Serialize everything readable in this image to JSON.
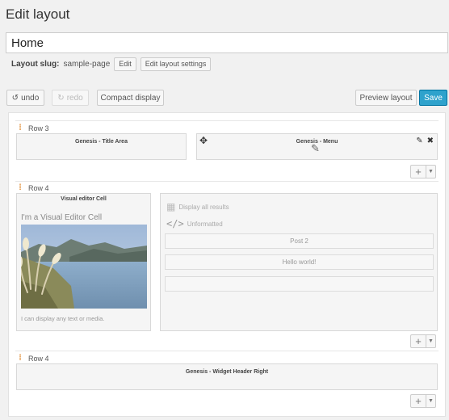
{
  "page": {
    "title": "Edit layout"
  },
  "layout_title": "Home",
  "slug": {
    "label": "Layout slug:",
    "value": "sample-page",
    "edit_button": "Edit",
    "settings_button": "Edit layout settings"
  },
  "toolbar": {
    "undo": "undo",
    "redo": "redo",
    "compact": "Compact display",
    "preview": "Preview layout",
    "save": "Save"
  },
  "rows": [
    {
      "label": "Row 3",
      "cells": [
        {
          "title": "Genesis - Title Area"
        },
        {
          "title": "Genesis - Menu"
        }
      ]
    },
    {
      "label": "Row 4",
      "cells": [
        {
          "title": "Visual editor Cell",
          "heading": "I'm a Visual Editor Cell",
          "caption": "I can display any text or media."
        },
        {
          "display_all": "Display all results",
          "format": "Unformatted",
          "posts": [
            "Post 2",
            "Hello world!",
            ""
          ]
        }
      ]
    },
    {
      "label": "Row 4",
      "cells": [
        {
          "title": "Genesis - Widget Header Right"
        }
      ]
    }
  ],
  "icons": {
    "undo": "undo-icon",
    "redo": "redo-icon",
    "grip": "drag-handle-icon",
    "move": "move-icon",
    "edit": "pencil-icon",
    "close": "close-icon",
    "add": "plus-icon",
    "dropdown": "caret-down-icon",
    "calendar": "calendar-icon",
    "code": "code-icon"
  },
  "colors": {
    "accent": "#2ea2cc",
    "grip": "#e08a2f"
  }
}
